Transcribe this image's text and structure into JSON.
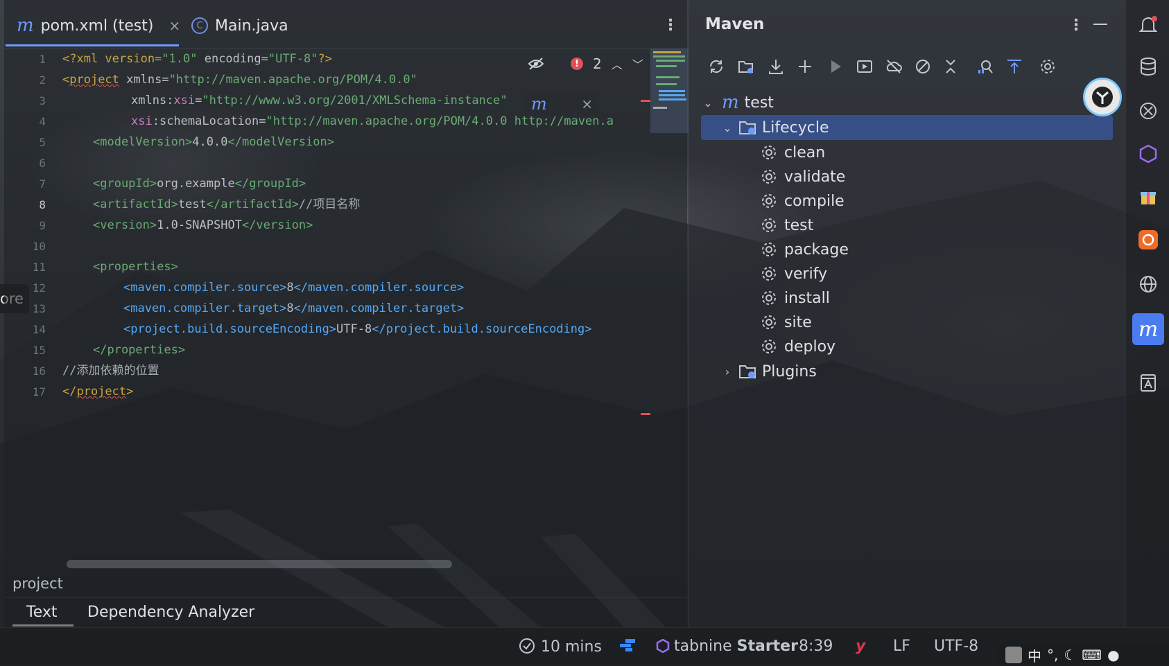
{
  "editor": {
    "tabs": [
      {
        "label": "pom.xml (test)",
        "icon": "maven-file-icon"
      },
      {
        "label": "Main.java",
        "icon": "java-class-icon"
      }
    ],
    "line_numbers": [
      "1",
      "2",
      "3",
      "4",
      "5",
      "6",
      "7",
      "8",
      "9",
      "10",
      "11",
      "12",
      "13",
      "14",
      "15",
      "16",
      "17"
    ],
    "current_line": "8",
    "inspections": {
      "error_count": "2"
    },
    "breadcrumb": "project",
    "bottom_tabs": [
      "Text",
      "Dependency Analyzer"
    ]
  },
  "code": {
    "l1": {
      "a": "<?xml version=",
      "b": "\"1.0\"",
      "c": " encoding=",
      "d": "\"UTF-8\"",
      "e": "?>"
    },
    "l2": {
      "a": "<",
      "b": "project",
      "c": " xmlns=",
      "d": "\"http://maven.apache.org/POM/4.0.0\""
    },
    "l3": {
      "a": "xmlns:",
      "b": "xsi",
      "c": "=",
      "d": "\"http://www.w3.org/2001/XMLSchema-instance\""
    },
    "l4": {
      "a": "xsi",
      "b": ":schemaLocation=",
      "c": "\"http://maven.apache.org/POM/4.0.0 http://maven.a"
    },
    "l5": {
      "a": "<modelVersion>",
      "b": "4.0.0",
      "c": "</modelVersion>"
    },
    "l7": {
      "a": "<groupId>",
      "b": "org.example",
      "c": "</groupId>"
    },
    "l8": {
      "a": "<artifactId>",
      "b": "test",
      "c": "</artifactId>",
      "d": "//项目名称"
    },
    "l9": {
      "a": "<version>",
      "b": "1.0-SNAPSHOT",
      "c": "</version>"
    },
    "l11": {
      "a": "<properties>"
    },
    "l12": {
      "a": "<maven.compiler.source>",
      "b": "8",
      "c": "</maven.compiler.source>"
    },
    "l13": {
      "a": "<maven.compiler.target>",
      "b": "8",
      "c": "</maven.compiler.target>"
    },
    "l14": {
      "a": "<project.build.sourceEncoding>",
      "b": "UTF-8",
      "c": "</project.build.sourceEncoding>"
    },
    "l15": {
      "a": "</properties>"
    },
    "l16": {
      "a": "//添加依赖的位置"
    },
    "l17": {
      "a": "</",
      "b": "project",
      "c": ">"
    }
  },
  "maven": {
    "title": "Maven",
    "toolbar": [
      "reload-icon",
      "generate-sources-icon",
      "download-icon",
      "add-icon",
      "run-icon",
      "execute-goal-icon",
      "offline-icon",
      "skip-tests-icon",
      "collapse-all-icon",
      "analyze-dependencies-icon",
      "show-diagram-icon",
      "settings-icon"
    ],
    "root": "test",
    "lifecycle_label": "Lifecycle",
    "lifecycle": [
      "clean",
      "validate",
      "compile",
      "test",
      "package",
      "verify",
      "install",
      "site",
      "deploy"
    ],
    "plugins_label": "Plugins"
  },
  "left_tooltip": "ore",
  "status": {
    "timer": "10 mins",
    "tabnine": "tabnine",
    "tabnine_plan": "Starter",
    "position": "8:39",
    "line_sep": "LF",
    "encoding": "UTF-8",
    "tray_text": "中"
  },
  "colors": {
    "accent": "#6f9bff",
    "selection": "#3a5aa0",
    "error": "#e0505a"
  }
}
